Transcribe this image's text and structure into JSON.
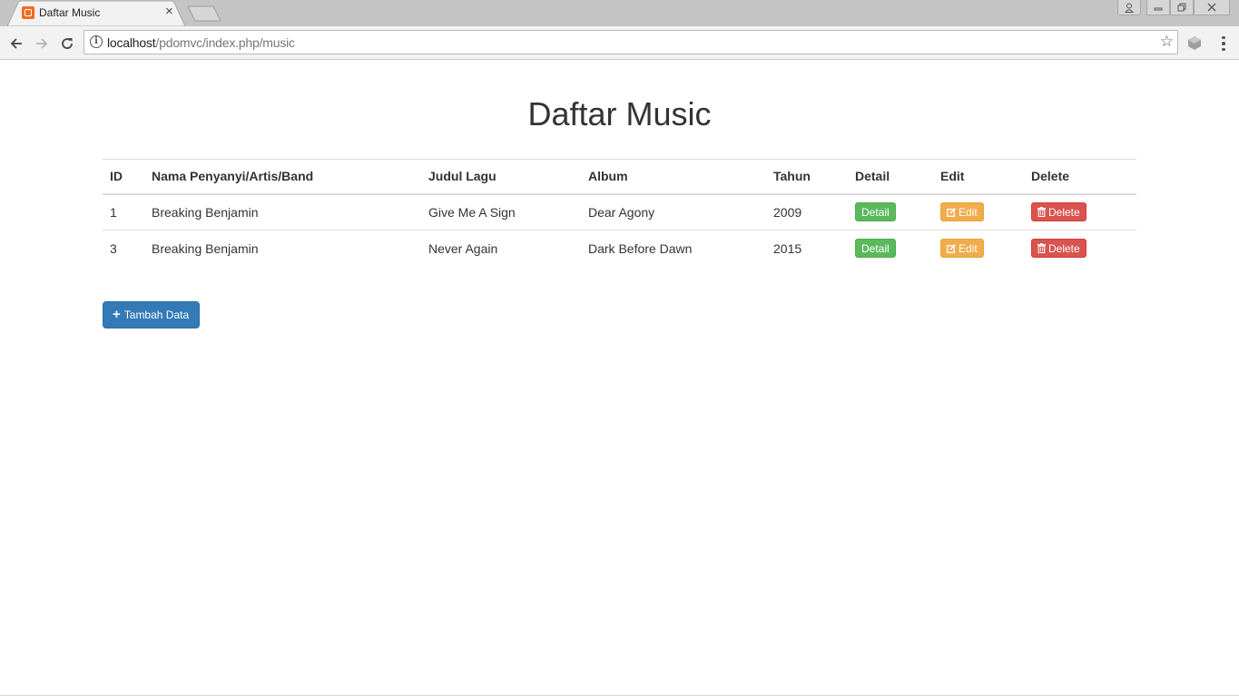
{
  "browser": {
    "tab_title": "Daftar Music",
    "tab_close": "×",
    "url_host": "localhost",
    "url_path": "/pdomvc/index.php/music",
    "info_glyph": "i",
    "star_glyph": "☆"
  },
  "page": {
    "title": "Daftar Music",
    "headers": [
      "ID",
      "Nama Penyanyi/Artis/Band",
      "Judul Lagu",
      "Album",
      "Tahun",
      "Detail",
      "Edit",
      "Delete"
    ],
    "rows": [
      {
        "id": "1",
        "artist": "Breaking Benjamin",
        "title": "Give Me A Sign",
        "album": "Dear Agony",
        "year": "2009"
      },
      {
        "id": "3",
        "artist": "Breaking Benjamin",
        "title": "Never Again",
        "album": "Dark Before Dawn",
        "year": "2015"
      }
    ],
    "buttons": {
      "detail": "Detail",
      "edit": "Edit",
      "delete": "Delete",
      "add": "Tambah Data",
      "add_glyph": "+"
    }
  },
  "colors": {
    "primary": "#337ab7",
    "success": "#5cb85c",
    "warning": "#f0ad4e",
    "danger": "#d9534f"
  }
}
